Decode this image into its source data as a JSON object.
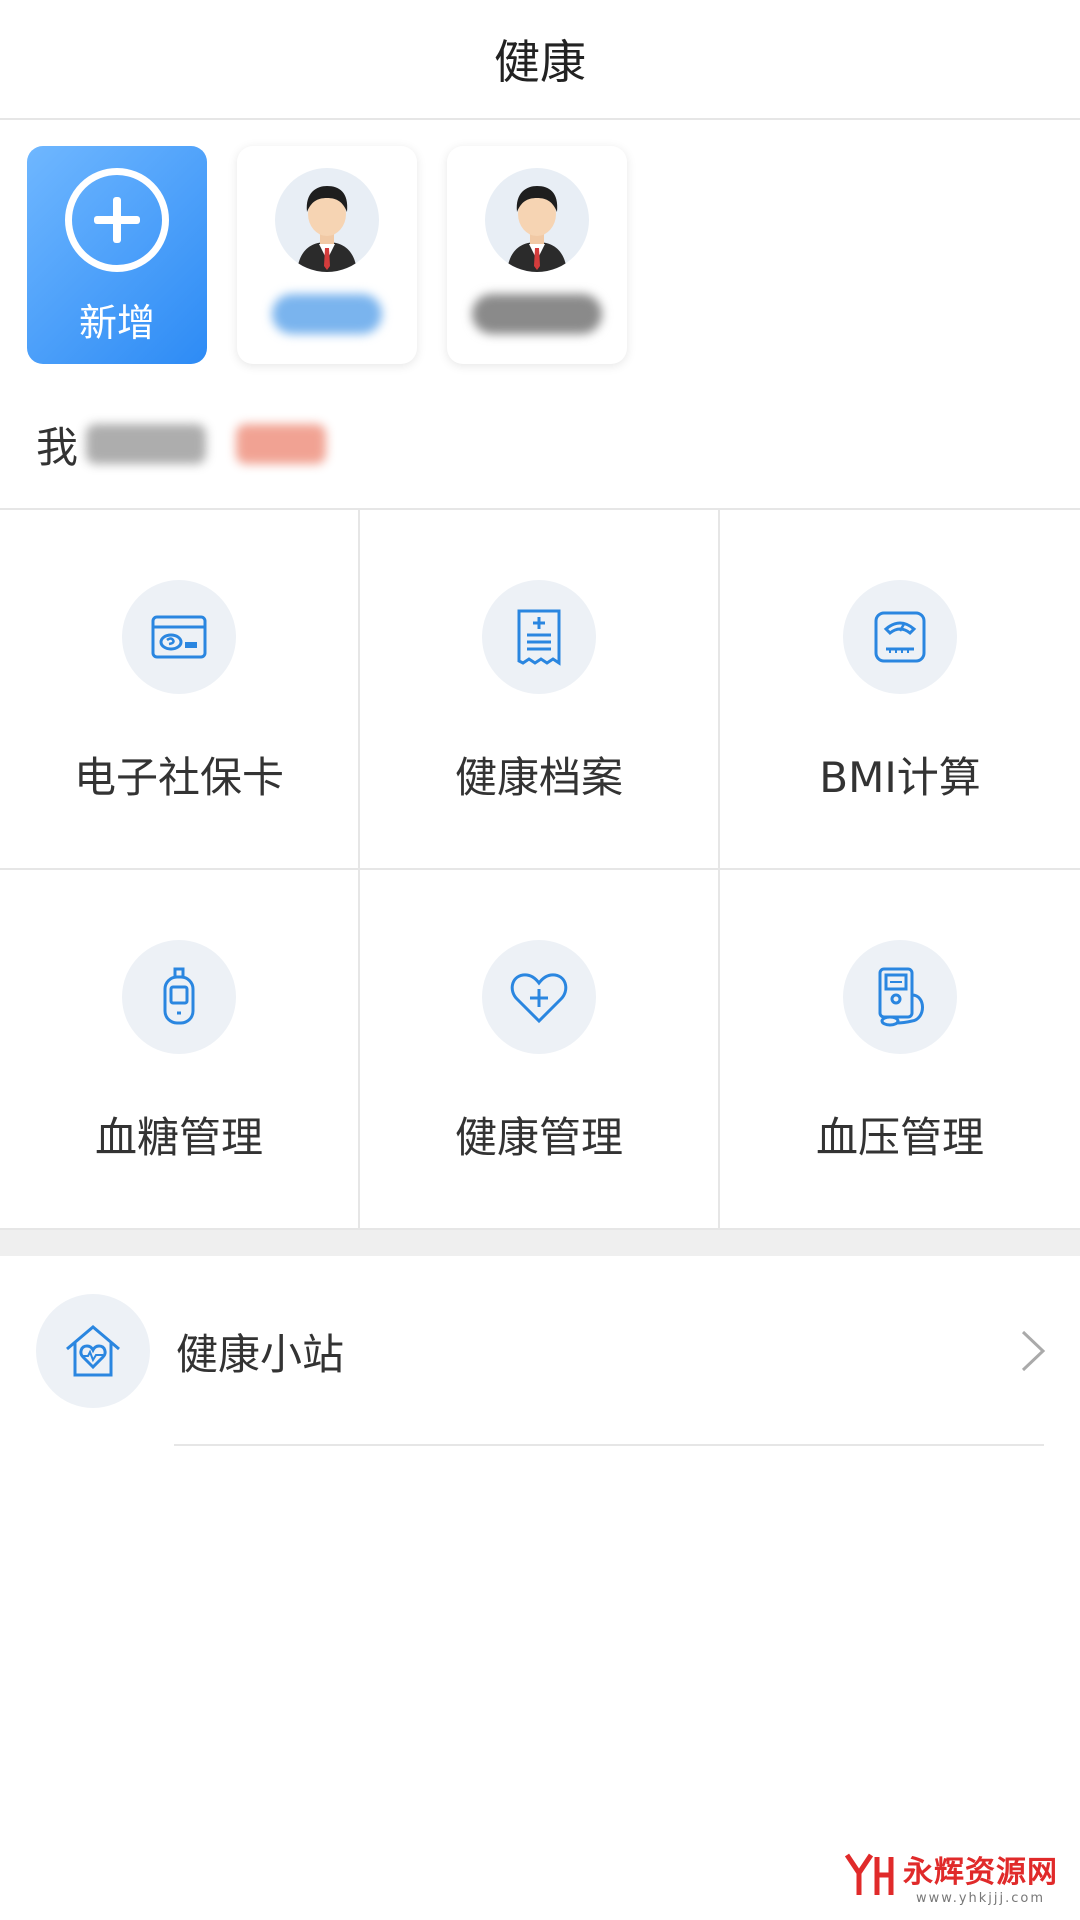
{
  "header": {
    "title": "健康"
  },
  "members": {
    "add_label": "新增",
    "list": [
      {
        "avatar_icon": "person-avatar-icon"
      },
      {
        "avatar_icon": "person-avatar-icon"
      }
    ]
  },
  "me": {
    "label": "我"
  },
  "grid": [
    {
      "label": "电子社保卡",
      "icon": "social-security-card-icon"
    },
    {
      "label": "健康档案",
      "icon": "health-record-icon"
    },
    {
      "label": "BMI计算",
      "icon": "scale-icon"
    },
    {
      "label": "血糖管理",
      "icon": "glucose-meter-icon"
    },
    {
      "label": "健康管理",
      "icon": "heart-plus-icon"
    },
    {
      "label": "血压管理",
      "icon": "blood-pressure-monitor-icon"
    }
  ],
  "station": {
    "label": "健康小站",
    "icon": "health-house-icon"
  },
  "watermark": {
    "title": "永辉资源网",
    "url": "www.yhkjjj.com"
  },
  "colors": {
    "accent": "#2d8bf5",
    "icon_blue": "#2a86e0",
    "icon_bg": "#edf1f6",
    "divider": "#e6e6e6"
  }
}
